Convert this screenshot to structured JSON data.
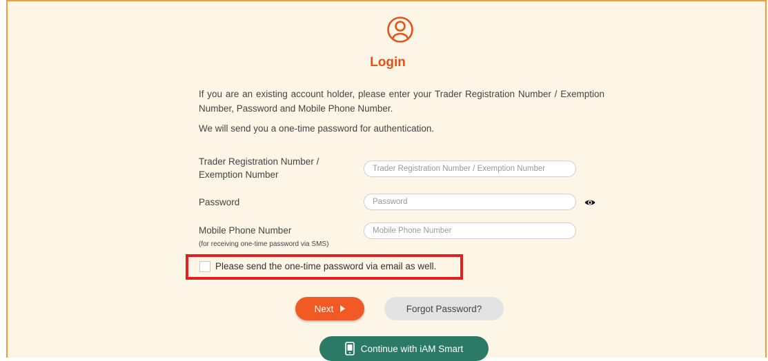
{
  "login": {
    "title": "Login",
    "intro": "If you are an existing account holder, please enter your Trader Registration Number / Exemption Number, Password and Mobile Phone Number.",
    "intro2": "We will send you a one-time password for authentication."
  },
  "fields": {
    "trn": {
      "label_line1": "Trader Registration Number /",
      "label_line2": "Exemption Number",
      "placeholder": "Trader Registration Number / Exemption Number",
      "value": ""
    },
    "password": {
      "label": "Password",
      "placeholder": "Password",
      "value": ""
    },
    "mobile": {
      "label": "Mobile Phone Number",
      "sublabel": "(for receiving one-time password via SMS)",
      "placeholder": "Mobile Phone Number",
      "value": ""
    }
  },
  "email_otp": {
    "label": "Please send the one-time password via email as well.",
    "checked": false
  },
  "buttons": {
    "next": "Next",
    "forgot": "Forgot Password?",
    "iam_smart": "Continue with iAM Smart"
  },
  "icons": {
    "user": "user-circle-icon",
    "eye": "eye-icon",
    "next_arrow": "play-arrow-icon",
    "iam": "iam-smart-icon"
  },
  "colors": {
    "accent": "#e8501a",
    "next_button": "#f15a24",
    "iam_button": "#2b7a66",
    "highlight_border": "#e41d1d",
    "background": "#fdf5e6"
  }
}
